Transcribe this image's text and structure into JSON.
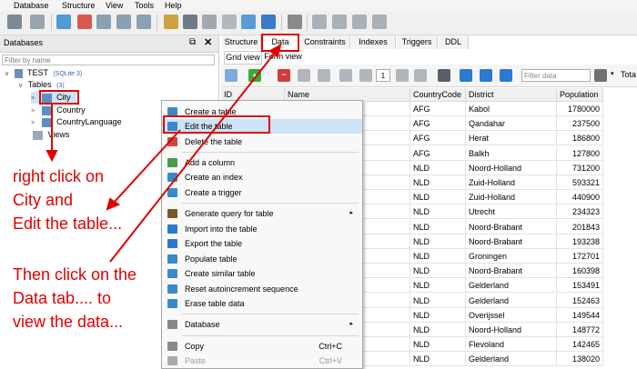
{
  "menubar": [
    "Database",
    "Structure",
    "View",
    "Tools",
    "Help"
  ],
  "left_panel": {
    "title": "Databases",
    "filter_placeholder": "Filter by name",
    "db_name": "TEST",
    "db_type": "(SQLite 3)",
    "tables_label": "Tables",
    "tables_count": "(3)",
    "tables": [
      "City",
      "Country",
      "CountryLanguage"
    ],
    "views_label": "Views"
  },
  "tabs": [
    "Structure",
    "Data",
    "Constraints",
    "Indexes",
    "Triggers",
    "DDL"
  ],
  "subtabs": [
    "Grid view",
    "Form view"
  ],
  "data_toolbar": {
    "page_number": "1",
    "filter_placeholder": "Filter data",
    "total_label": "Tota"
  },
  "grid": {
    "columns": [
      "ID",
      "Name",
      "CountryCode",
      "District",
      "Population"
    ],
    "rows": [
      [
        "AFG",
        "Kabol",
        "1780000"
      ],
      [
        "AFG",
        "Qandahar",
        "237500"
      ],
      [
        "AFG",
        "Herat",
        "186800"
      ],
      [
        "AFG",
        "Balkh",
        "127800"
      ],
      [
        "NLD",
        "Noord-Holland",
        "731200"
      ],
      [
        "NLD",
        "Zuid-Holland",
        "593321"
      ],
      [
        "NLD",
        "Zuid-Holland",
        "440900"
      ],
      [
        "NLD",
        "Utrecht",
        "234323"
      ],
      [
        "NLD",
        "Noord-Brabant",
        "201843"
      ],
      [
        "NLD",
        "Noord-Brabant",
        "193238"
      ],
      [
        "NLD",
        "Groningen",
        "172701"
      ],
      [
        "NLD",
        "Noord-Brabant",
        "160398"
      ],
      [
        "NLD",
        "Gelderland",
        "153491"
      ],
      [
        "NLD",
        "Gelderland",
        "152463"
      ],
      [
        "NLD",
        "Overijssel",
        "149544"
      ],
      [
        "NLD",
        "Noord-Holland",
        "148772"
      ],
      [
        "NLD",
        "Flevoland",
        "142465"
      ],
      [
        "NLD",
        "Gelderland",
        "138020"
      ]
    ]
  },
  "context_menu": {
    "items": [
      {
        "label": "Create a table",
        "icon": "create-table-icon",
        "color": "#3a8ac9"
      },
      {
        "label": "Edit the table",
        "icon": "edit-table-icon",
        "color": "#3a8ac9"
      },
      {
        "label": "Delete the table",
        "icon": "delete-table-icon",
        "color": "#c94a3a"
      },
      {
        "label": "Add a column",
        "icon": "add-column-icon",
        "color": "#4a9a4a"
      },
      {
        "label": "Create an index",
        "icon": "create-index-icon",
        "color": "#3a8ac9"
      },
      {
        "label": "Create a trigger",
        "icon": "create-trigger-icon",
        "color": "#3a8ac9"
      },
      {
        "label": "Generate query for table",
        "icon": "generate-query-icon",
        "color": "#7a5a2a"
      },
      {
        "label": "Import into the table",
        "icon": "import-icon",
        "color": "#2a7ac9"
      },
      {
        "label": "Export the table",
        "icon": "export-icon",
        "color": "#2a7ac9"
      },
      {
        "label": "Populate table",
        "icon": "populate-icon",
        "color": "#3a8ac9"
      },
      {
        "label": "Create similar table",
        "icon": "similar-table-icon",
        "color": "#3a8ac9"
      },
      {
        "label": "Reset autoincrement sequence",
        "icon": "reset-icon",
        "color": "#3a8ac9"
      },
      {
        "label": "Erase table data",
        "icon": "erase-icon",
        "color": "#3a8ac9"
      },
      {
        "label": "Database",
        "icon": "database-icon",
        "color": "#888888"
      },
      {
        "label": "Copy",
        "icon": "copy-icon",
        "color": "#888888"
      },
      {
        "label": "Paste",
        "icon": "paste-icon",
        "color": "#aaaaaa"
      }
    ],
    "copy_shortcut": "Ctrl+C",
    "paste_shortcut": "Ctrl+V"
  },
  "annotation": {
    "lines": [
      "right click on",
      "City and",
      "Edit the table...",
      "Then click on the",
      "Data tab.... to",
      "view the data..."
    ],
    "color": "#e00000"
  }
}
